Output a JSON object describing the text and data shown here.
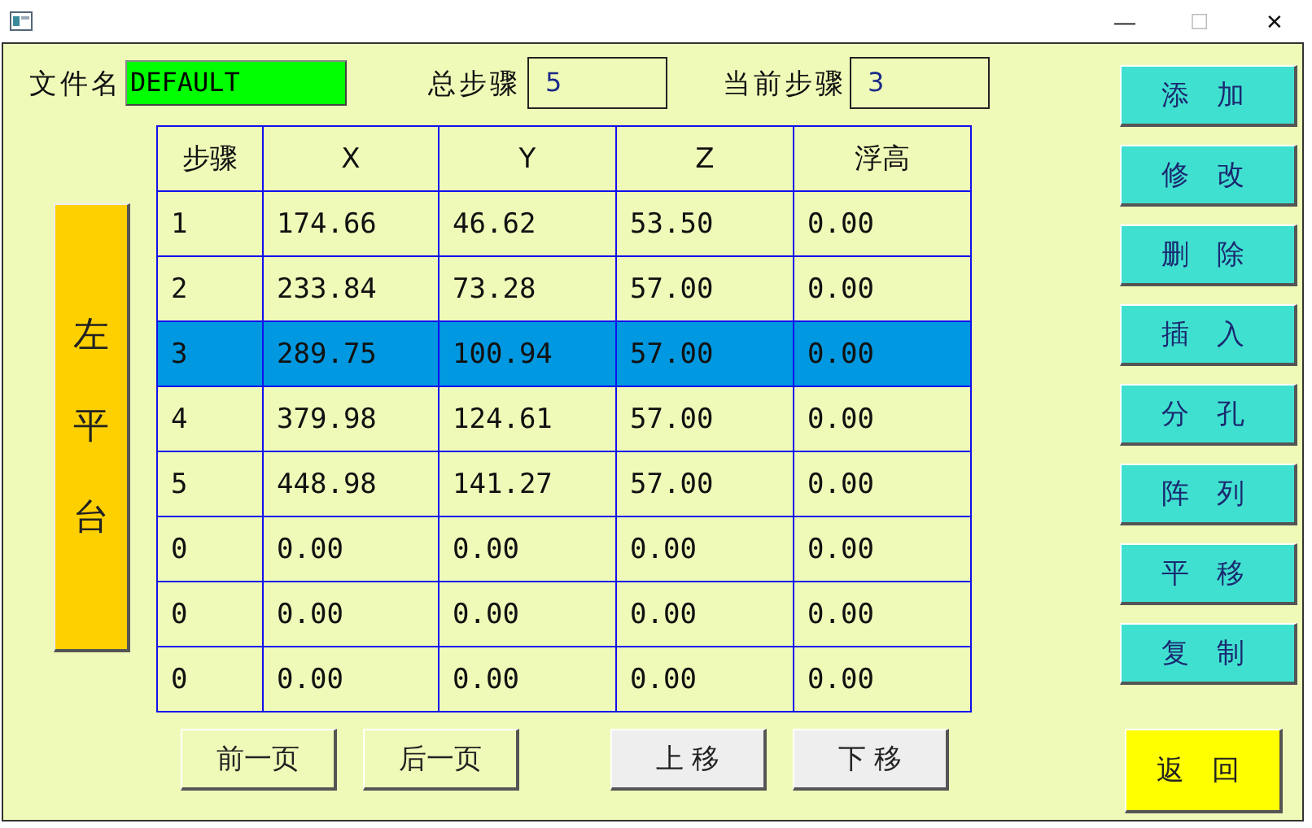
{
  "window": {
    "controls": [
      {
        "kind": "minimize",
        "label": "—"
      },
      {
        "kind": "maximize",
        "label": "☐"
      },
      {
        "kind": "close",
        "label": "✕"
      }
    ]
  },
  "header": {
    "file_label": "文件名",
    "file_value": "DEFAULT",
    "total_label": "总步骤",
    "total_value": "5",
    "current_label": "当前步骤",
    "current_value": "3"
  },
  "platform_button": "左平台",
  "table": {
    "columns": [
      "步骤",
      "X",
      "Y",
      "Z",
      "浮高"
    ],
    "rows": [
      {
        "cells": [
          "1",
          "174.66",
          "46.62",
          "53.50",
          "0.00"
        ],
        "selected": false
      },
      {
        "cells": [
          "2",
          "233.84",
          "73.28",
          "57.00",
          "0.00"
        ],
        "selected": false
      },
      {
        "cells": [
          "3",
          "289.75",
          "100.94",
          "57.00",
          "0.00"
        ],
        "selected": true
      },
      {
        "cells": [
          "4",
          "379.98",
          "124.61",
          "57.00",
          "0.00"
        ],
        "selected": false
      },
      {
        "cells": [
          "5",
          "448.98",
          "141.27",
          "57.00",
          "0.00"
        ],
        "selected": false
      },
      {
        "cells": [
          "0",
          "0.00",
          "0.00",
          "0.00",
          "0.00"
        ],
        "selected": false
      },
      {
        "cells": [
          "0",
          "0.00",
          "0.00",
          "0.00",
          "0.00"
        ],
        "selected": false
      },
      {
        "cells": [
          "0",
          "0.00",
          "0.00",
          "0.00",
          "0.00"
        ],
        "selected": false
      }
    ]
  },
  "bottom_buttons": [
    {
      "label": "前一页",
      "kind": "page"
    },
    {
      "label": "后一页",
      "kind": "page"
    },
    {
      "label": "上 移",
      "kind": "move"
    },
    {
      "label": "下 移",
      "kind": "move"
    }
  ],
  "side_buttons": [
    "添 加",
    "修 改",
    "删 除",
    "插 入",
    "分 孔",
    "阵 列",
    "平 移",
    "复 制"
  ],
  "return_button": "返 回"
}
